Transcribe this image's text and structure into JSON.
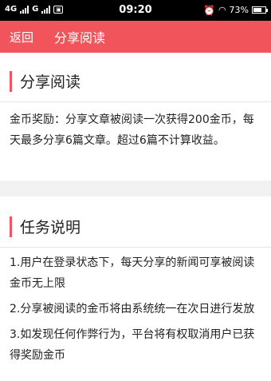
{
  "status_bar": {
    "network_1": "4G",
    "network_2": "G",
    "time": "09:20",
    "battery": "73%",
    "battery_level": 0.73,
    "icons": [
      "signal-icon",
      "app-icon",
      "alarm-icon",
      "wifi-icon",
      "battery-icon"
    ]
  },
  "nav": {
    "back_label": "返回",
    "title": "分享阅读"
  },
  "reward": {
    "heading": "分享阅读",
    "text": "金币奖励：分享文章被阅读一次获得200金币，每天最多分享6篇文章。超过6篇不计算收益。"
  },
  "task": {
    "heading": "任务说明",
    "items": [
      "1.用户在登录状态下，每天分享的新闻可享被阅读金币无上限",
      "2.分享被阅读的金币将由系统统一在次日进行发放",
      "3.如发现任何作弊行为，平台将有权取消用户已获得奖励金币"
    ]
  },
  "colors": {
    "accent": "#f1545b",
    "background_gap": "#f2f2f2"
  }
}
